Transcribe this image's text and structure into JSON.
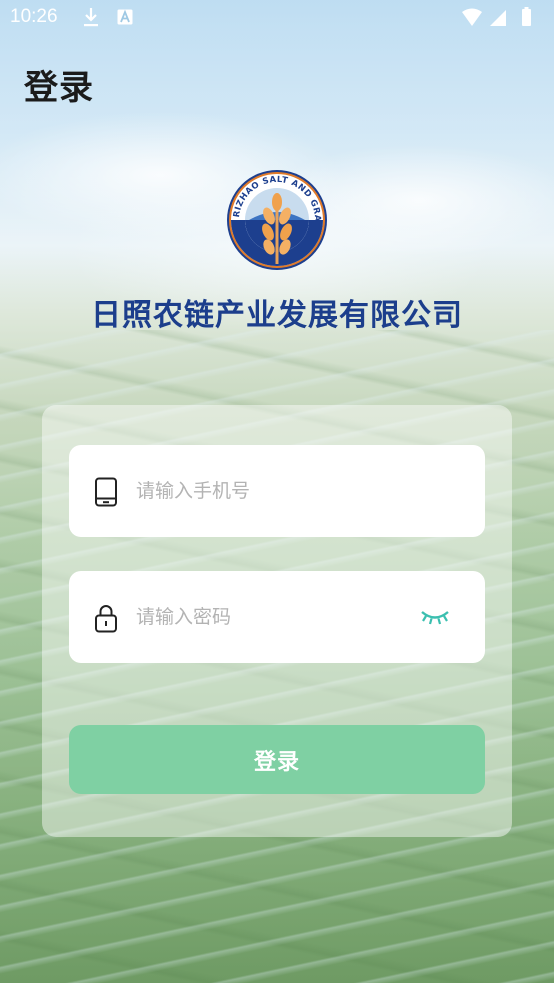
{
  "status_bar": {
    "time": "10:26",
    "icons": [
      "download-icon",
      "font-a-icon",
      "wifi-icon",
      "signal-icon",
      "battery-icon"
    ]
  },
  "header": {
    "title": "登录"
  },
  "logo": {
    "ring_text": "RIZHAO SALT AND GRAIN",
    "icon": "wheat-icon"
  },
  "company_name": "日照农链产业发展有限公司",
  "form": {
    "phone": {
      "placeholder": "请输入手机号",
      "value": "",
      "icon": "phone-icon"
    },
    "password": {
      "placeholder": "请输入密码",
      "value": "",
      "icon": "lock-icon",
      "toggle_icon": "eye-closed-icon"
    },
    "submit_label": "登录"
  },
  "colors": {
    "title": "#1b1b1b",
    "company": "#1c3e8c",
    "button": "#7fd0a3",
    "eye_toggle": "#3bbfb0"
  }
}
